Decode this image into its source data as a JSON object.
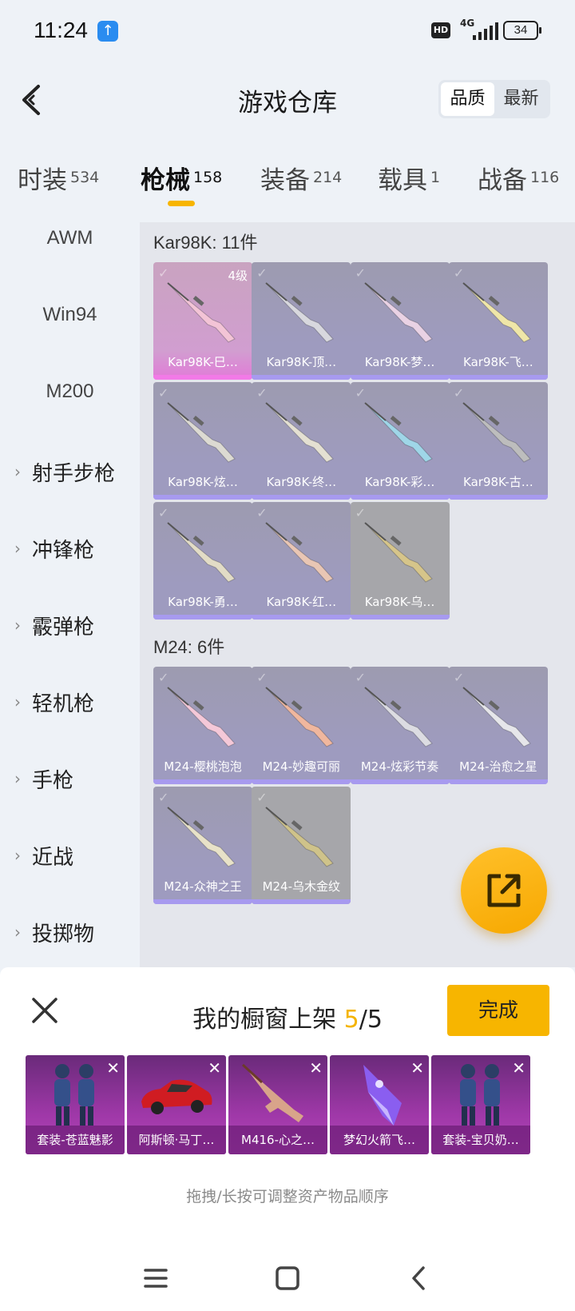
{
  "status": {
    "time": "11:24",
    "network": "4G",
    "hd": "HD",
    "battery": "34"
  },
  "header": {
    "title": "游戏仓库",
    "sort_options": [
      "品质",
      "最新"
    ],
    "sort_active": 0
  },
  "categories": [
    {
      "label": "时装",
      "count": "534"
    },
    {
      "label": "枪械",
      "count": "158"
    },
    {
      "label": "装备",
      "count": "214"
    },
    {
      "label": "载具",
      "count": "1"
    },
    {
      "label": "战备",
      "count": "116"
    }
  ],
  "active_category": 1,
  "sidebar": {
    "sub_items": [
      "AWM",
      "Win94",
      "M200"
    ],
    "groups": [
      "射手步枪",
      "冲锋枪",
      "霰弹枪",
      "轻机枪",
      "手枪",
      "近战",
      "投掷物"
    ]
  },
  "groups": [
    {
      "title": "Kar98K: 11件",
      "items": [
        {
          "name": "Kar98K-巳…",
          "level": "4级",
          "style": "pink"
        },
        {
          "name": "Kar98K-顶…",
          "style": "purple"
        },
        {
          "name": "Kar98K-梦…",
          "style": "purple"
        },
        {
          "name": "Kar98K-飞…",
          "style": "purple"
        },
        {
          "name": "Kar98K-炫…",
          "style": "purple"
        },
        {
          "name": "Kar98K-终…",
          "style": "purple"
        },
        {
          "name": "Kar98K-彩…",
          "style": "purple"
        },
        {
          "name": "Kar98K-古…",
          "style": "purple"
        },
        {
          "name": "Kar98K-勇…",
          "style": "purple"
        },
        {
          "name": "Kar98K-红…",
          "style": "purple"
        },
        {
          "name": "Kar98K-乌…",
          "style": "gray"
        }
      ]
    },
    {
      "title": "M24: 6件",
      "items": [
        {
          "name": "M24-樱桃泡泡",
          "style": "purple"
        },
        {
          "name": "M24-妙趣可丽",
          "style": "purple"
        },
        {
          "name": "M24-炫彩节奏",
          "style": "purple"
        },
        {
          "name": "M24-治愈之星",
          "style": "purple"
        },
        {
          "name": "M24-众神之王",
          "style": "purple"
        },
        {
          "name": "M24-乌木金纹",
          "style": "gray"
        }
      ]
    }
  ],
  "showcase": {
    "title_prefix": "我的橱窗上架 ",
    "count_current": "5",
    "count_sep": "/",
    "count_max": "5",
    "done_label": "完成",
    "items": [
      {
        "name": "套装-苍蓝魅影",
        "icon": "outfit-icon"
      },
      {
        "name": "阿斯顿·马丁…",
        "icon": "car-icon"
      },
      {
        "name": "M416-心之…",
        "icon": "rifle-icon"
      },
      {
        "name": "梦幻火箭飞…",
        "icon": "glider-icon"
      },
      {
        "name": "套装-宝贝奶…",
        "icon": "outfit-icon"
      }
    ],
    "hint": "拖拽/长按可调整资产物品顺序"
  }
}
